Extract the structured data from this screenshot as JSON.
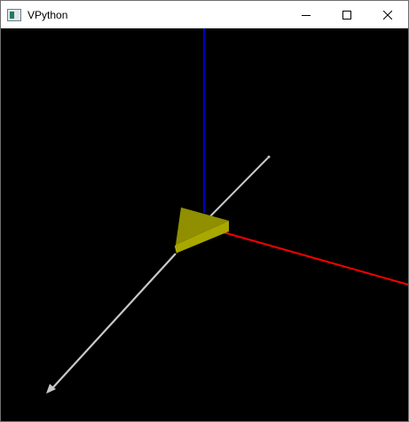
{
  "window": {
    "title": "VPython"
  },
  "icons": {
    "app": "vpython-app-icon",
    "minimize": "minimize-icon",
    "maximize": "maximize-icon",
    "close": "close-icon"
  },
  "scene": {
    "background": "#000000",
    "axis_colors": {
      "x_axis": "#ff0000",
      "y_axis": "#0000ff",
      "diagonal_arrow": "#c8c8c8"
    },
    "object_color": "#a8a800"
  }
}
